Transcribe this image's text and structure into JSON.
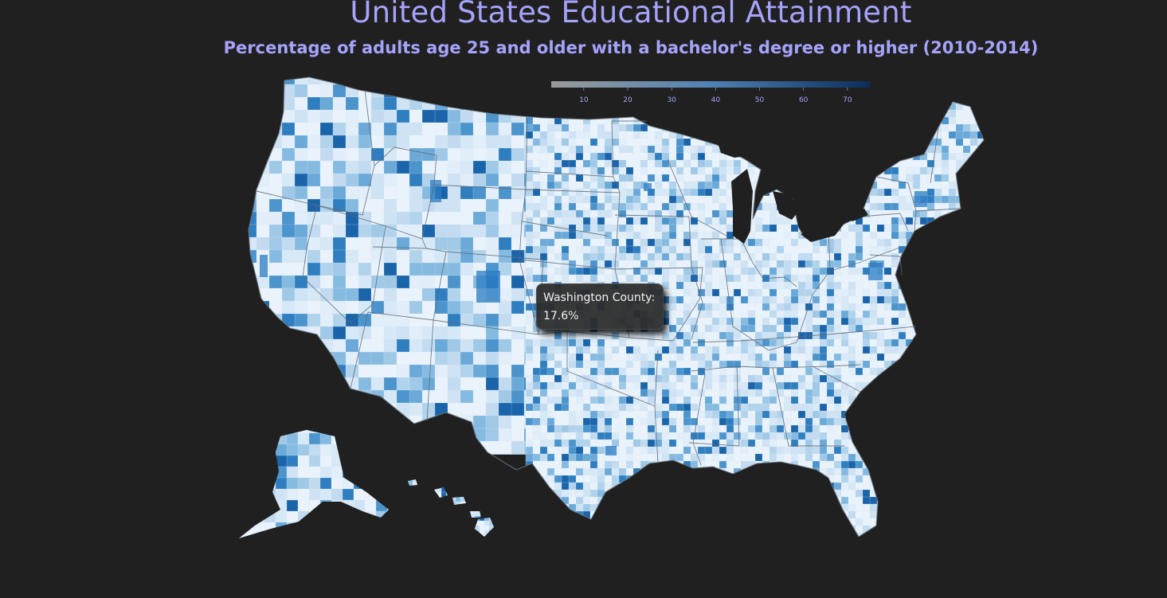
{
  "header": {
    "title": "United States Educational Attainment",
    "subtitle": "Percentage of adults age 25 and older with a bachelor's degree or higher (2010-2014)"
  },
  "legend": {
    "ticks": [
      "10",
      "20",
      "30",
      "40",
      "50",
      "60",
      "70"
    ],
    "min_value": 2.6,
    "max_value": 75.1,
    "color_low": "#9a9a9a",
    "color_high": "#0a2d58"
  },
  "tooltip": {
    "line1": "Washington County:",
    "line2": "17.6%"
  },
  "colors": {
    "background": "#202020",
    "title": "#a5a3fb",
    "county_light": "#e4eff9",
    "county_mid": "#8ec3e5",
    "county_dark": "#2b7cc3",
    "state_border": "#5e6b78"
  }
}
